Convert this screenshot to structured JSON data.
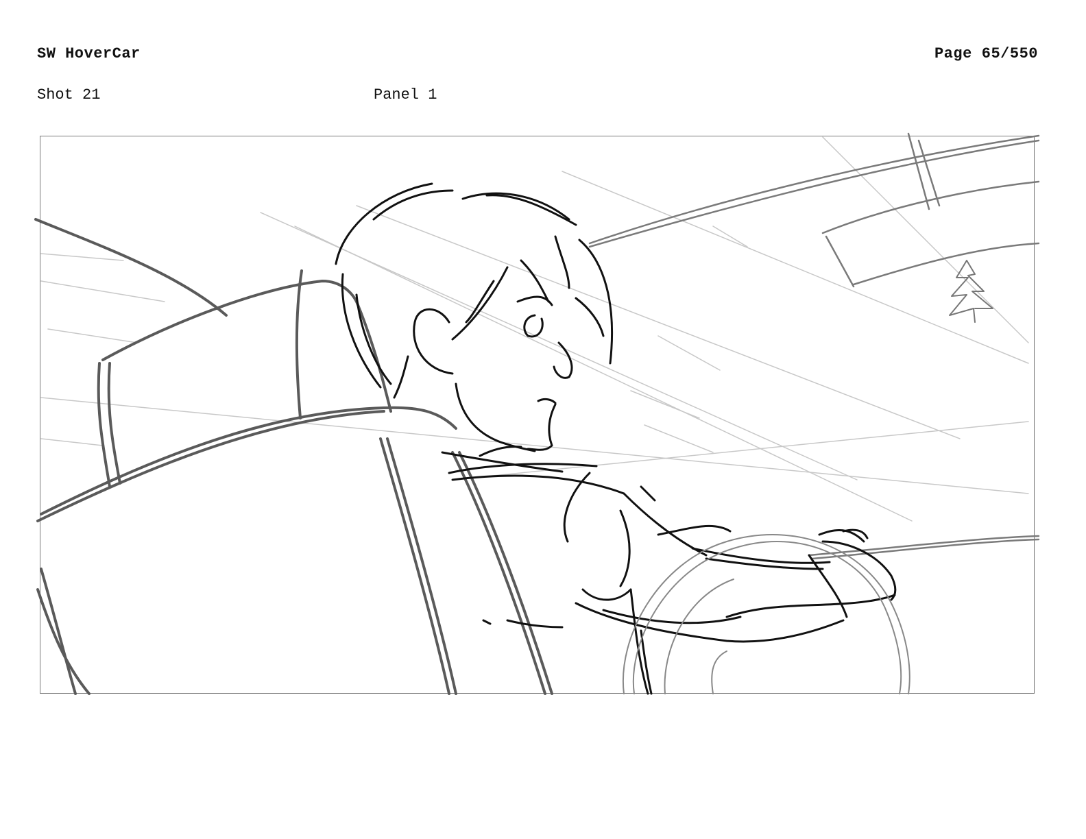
{
  "header": {
    "title": "SW HoverCar",
    "page_label": "Page",
    "page_number": "65/550"
  },
  "meta": {
    "shot": "Shot 21",
    "panel": "Panel 1"
  },
  "colors": {
    "ink_dark": "#111111",
    "ink_mid": "#666666",
    "ink_light": "#bbbbbb",
    "frame": "#777777"
  }
}
